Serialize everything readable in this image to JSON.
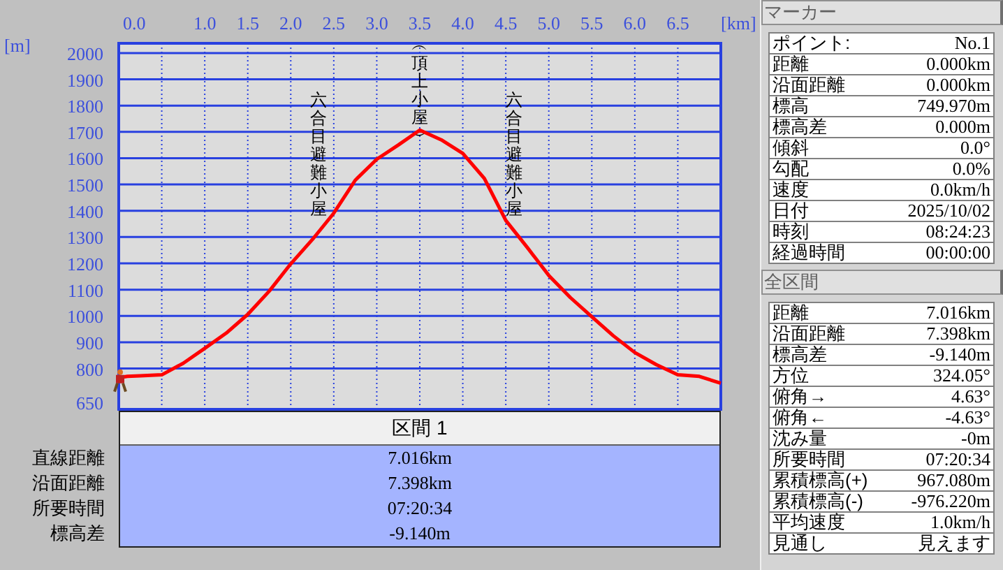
{
  "profile": {
    "chart_data": {
      "type": "line",
      "xlabel": "[km]",
      "ylabel": "[m]",
      "xlim": [
        0,
        7.0
      ],
      "ylim": [
        650,
        2037
      ],
      "grid": true,
      "xticks": [
        {
          "value": 0,
          "label": "0.0"
        },
        {
          "value": 1,
          "label": "1.0"
        },
        {
          "value": 1.5,
          "label": "1.5"
        },
        {
          "value": 2,
          "label": "2.0"
        },
        {
          "value": 2.5,
          "label": "2.5"
        },
        {
          "value": 3,
          "label": "3.0"
        },
        {
          "value": 3.5,
          "label": "3.5"
        },
        {
          "value": 4,
          "label": "4.0"
        },
        {
          "value": 4.5,
          "label": "4.5"
        },
        {
          "value": 5,
          "label": "5.0"
        },
        {
          "value": 5.5,
          "label": "5.5"
        },
        {
          "value": 6,
          "label": "6.0"
        },
        {
          "value": 6.5,
          "label": "6.5"
        }
      ],
      "yticks": [
        650,
        800,
        900,
        1000,
        1100,
        1200,
        1300,
        1400,
        1500,
        1600,
        1700,
        1800,
        1900,
        2000
      ],
      "x": [
        0,
        0.1,
        0.25,
        0.5,
        0.75,
        1.0,
        1.25,
        1.5,
        1.75,
        2.0,
        2.25,
        2.5,
        2.75,
        3.0,
        3.25,
        3.5,
        3.75,
        4.0,
        4.25,
        4.5,
        4.75,
        5.0,
        5.25,
        5.5,
        5.75,
        6.0,
        6.25,
        6.5,
        6.75,
        7.0
      ],
      "series": [
        {
          "color": "#ff0000",
          "values": [
            765,
            770,
            772,
            776,
            820,
            877,
            935,
            1006,
            1095,
            1198,
            1290,
            1391,
            1516,
            1596,
            1650,
            1707,
            1670,
            1618,
            1523,
            1363,
            1260,
            1154,
            1070,
            997,
            925,
            861,
            815,
            776,
            770,
            744
          ]
        }
      ],
      "annotations": [
        "六合目避難小屋",
        "︵頂上小屋︶",
        "六合目避難小屋"
      ]
    }
  },
  "section_table": {
    "header": "区間 1",
    "rows": [
      {
        "label": "直線距離",
        "value": "7.016km"
      },
      {
        "label": "沿面距離",
        "value": "7.398km"
      },
      {
        "label": "所要時間",
        "value": "07:20:34"
      },
      {
        "label": "標高差",
        "value": "-9.140m"
      }
    ]
  },
  "marker": {
    "title": "マーカー",
    "rows": [
      {
        "label": "ポイント:",
        "value": "No.1"
      },
      {
        "label": "距離",
        "value": "0.000km"
      },
      {
        "label": "沿面距離",
        "value": "0.000km"
      },
      {
        "label": "標高",
        "value": "749.970m"
      },
      {
        "label": "標高差",
        "value": "0.000m"
      },
      {
        "label": "傾斜",
        "value": "0.0°"
      },
      {
        "label": "勾配",
        "value": "0.0%"
      },
      {
        "label": "速度",
        "value": "0.0km/h"
      },
      {
        "label": "日付",
        "value": "2025/10/02"
      },
      {
        "label": "時刻",
        "value": "08:24:23"
      },
      {
        "label": "経過時間",
        "value": "00:00:00"
      }
    ]
  },
  "total": {
    "title": "全区間",
    "rows": [
      {
        "label": "距離",
        "value": "7.016km"
      },
      {
        "label": "沿面距離",
        "value": "7.398km"
      },
      {
        "label": "標高差",
        "value": "-9.140m"
      },
      {
        "label": "方位",
        "value": "324.05°"
      },
      {
        "label": "俯角→",
        "value": "4.63°"
      },
      {
        "label": "俯角←",
        "value": "-4.63°"
      },
      {
        "label": "沈み量",
        "value": "-0m"
      },
      {
        "label": "所要時間",
        "value": "07:20:34"
      },
      {
        "label": "累積標高(+)",
        "value": "967.080m"
      },
      {
        "label": "累積標高(-)",
        "value": "-976.220m"
      },
      {
        "label": "平均速度",
        "value": "1.0km/h"
      },
      {
        "label": "見通し",
        "value": "見えます"
      }
    ]
  }
}
